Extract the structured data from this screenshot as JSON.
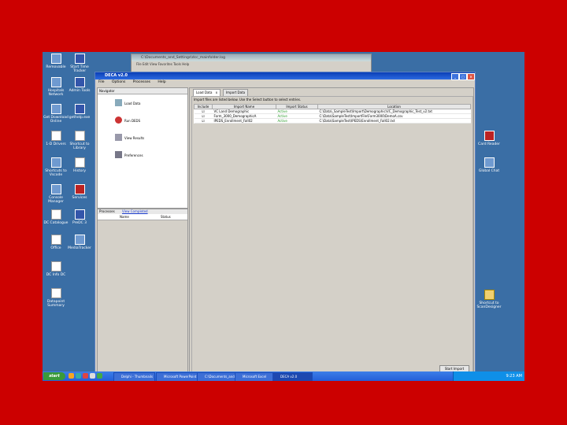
{
  "desktop_icons": [
    {
      "label": "Removable",
      "icon": "drive-icon"
    },
    {
      "label": "Start Time Tracker",
      "icon": "clock-icon"
    },
    {
      "label": "Hospitals Network",
      "icon": "network-icon"
    },
    {
      "label": "Admin Tools",
      "icon": "tools-icon"
    },
    {
      "label": "Get Download Online",
      "icon": "download-icon"
    },
    {
      "label": "gethelp.exe",
      "icon": "help-icon"
    },
    {
      "label": "1-D Drivers",
      "icon": "document-icon"
    },
    {
      "label": "Shortcut to Library",
      "icon": "shortcut-icon"
    },
    {
      "label": "Shortcuts to Vscode",
      "icon": "folder-icon"
    },
    {
      "label": "History",
      "icon": "history-icon"
    },
    {
      "label": "Console Manager",
      "icon": "console-icon"
    },
    {
      "label": "Services",
      "icon": "services-icon"
    },
    {
      "label": "DC Catalogue",
      "icon": "document-icon"
    },
    {
      "label": "PreDC 3",
      "icon": "app-icon"
    },
    {
      "label": "Office",
      "icon": "document-icon"
    },
    {
      "label": "MediaTracker",
      "icon": "media-icon"
    },
    {
      "label": "DC Info DC",
      "icon": "document-icon"
    },
    {
      "label": "Datapoint Summary",
      "icon": "document-icon"
    },
    {
      "label": "Card Reader",
      "icon": "app-icon"
    },
    {
      "label": "Global Chat",
      "icon": "chat-icon"
    },
    {
      "label": "Shortcut to ScanDesigner",
      "icon": "folder-icon"
    }
  ],
  "back_window": {
    "title": "C:\\Documents_and_Settings\\dcc_mainfolder.log",
    "menu": "File  Edit  View  Favorites  Tools  Help"
  },
  "app": {
    "title": "DECA v2.0",
    "menu": [
      "File",
      "Options",
      "Processes",
      "Help"
    ],
    "navigator_title": "Navigator",
    "nav_items": [
      {
        "label": "Load Data",
        "icon": "load-data-icon"
      },
      {
        "label": "Run DEDS",
        "icon": "run-deds-icon"
      },
      {
        "label": "View Results",
        "icon": "view-results-icon"
      },
      {
        "label": "Preferences",
        "icon": "preferences-icon"
      }
    ],
    "process_panel": {
      "title": "Processes",
      "link": "View Completed",
      "columns": [
        "Name",
        "Status"
      ]
    },
    "tabs": [
      {
        "label": "Load Data",
        "close": "x"
      },
      {
        "label": "Import Data"
      }
    ],
    "info_text": "Import files are listed below. Use the Select button to select entries.",
    "grid_columns": [
      "Include",
      "Import Name",
      "Import Status",
      "Location"
    ],
    "grid_rows": [
      {
        "include": "☑",
        "name": "VC Land Demographic",
        "status": "Active",
        "location": "C:\\Data\\_SampleTest\\Import\\Demographic\\VC_Demographic_Test_v2.txt"
      },
      {
        "include": "☑",
        "name": "Form_3000_DemographicA",
        "status": "Active",
        "location": "C:\\Data\\SampleTest\\ImportFile\\Form3000\\DemoA.csv"
      },
      {
        "include": "☑",
        "name": "IPEDS_Enrollment_Fall02",
        "status": "Active",
        "location": "C:\\Data\\SampleTest\\IPEDS\\Enrollment_Fall02.txt"
      }
    ],
    "start_button": "Start Import"
  },
  "taskbar": {
    "start": "start",
    "buttons": [
      {
        "label": "Delphi - Thumbnails"
      },
      {
        "label": "Microsoft PowerPoint"
      },
      {
        "label": "C:\\Documents_and..."
      },
      {
        "label": "Microsoft Excel"
      },
      {
        "label": "DECA v2.0",
        "active": true
      }
    ],
    "clock": "9:23 AM"
  }
}
